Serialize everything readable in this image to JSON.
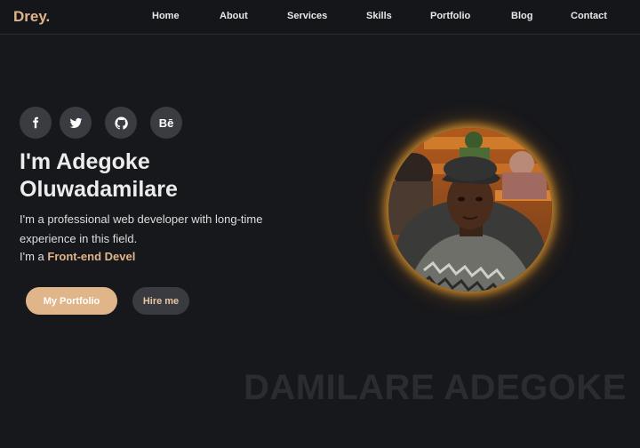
{
  "brand": {
    "logo": "Drey.",
    "accent_color": "#e0b488"
  },
  "nav": {
    "items": [
      {
        "label": "Home"
      },
      {
        "label": "About"
      },
      {
        "label": "Services"
      },
      {
        "label": "Skills"
      },
      {
        "label": "Portfolio"
      },
      {
        "label": "Blog"
      },
      {
        "label": "Contact"
      }
    ]
  },
  "hero": {
    "socials": [
      {
        "icon": "facebook-icon"
      },
      {
        "icon": "twitter-icon"
      },
      {
        "icon": "github-icon"
      },
      {
        "icon": "behance-icon",
        "text": "Bē"
      }
    ],
    "title_line1": "I'm Adegoke",
    "title_line2": "Oluwadamilare",
    "description": "I'm a professional web developer with long-time experience in this field.",
    "role_prefix": "I'm a",
    "role_typed": "Front-end Devel",
    "primary_button": "My Portfolio",
    "secondary_button": "Hire me",
    "avatar_glow_color": "#e8a032"
  },
  "watermark": "DAMILARE ADEGOKE"
}
